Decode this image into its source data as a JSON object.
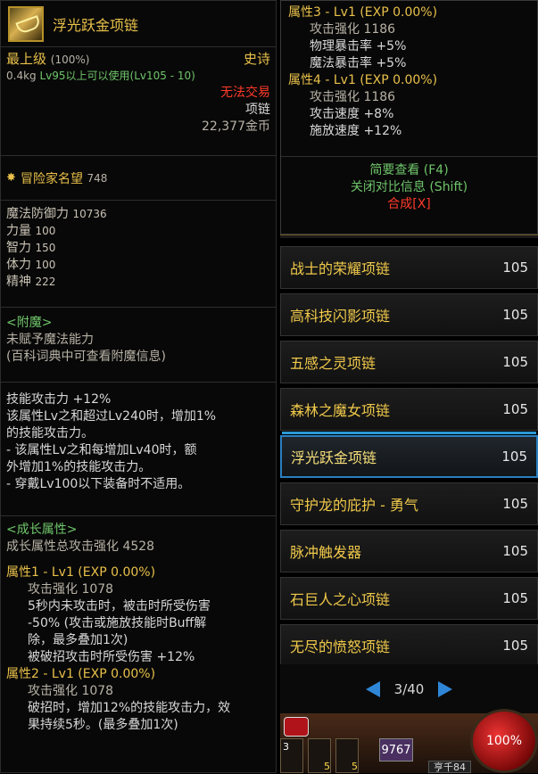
{
  "tooltip": {
    "item_name": "浮光跃金项链",
    "rarity": "最上级",
    "rarity_pct": "(100%)",
    "grade": "史诗",
    "weight": "0.4kg",
    "level_req": "Lv95以上可以使用(Lv105 - 10)",
    "trade": "无法交易",
    "slot": "项链",
    "price": "22,377金币",
    "fame_label": "冒险家名望",
    "fame_value": "748",
    "stats": [
      {
        "name": "魔法防御力",
        "value": "10736"
      },
      {
        "name": "力量",
        "value": "100"
      },
      {
        "name": "智力",
        "value": "150"
      },
      {
        "name": "体力",
        "value": "100"
      },
      {
        "name": "精神",
        "value": "222"
      }
    ],
    "enchant_title": "<附魔>",
    "enchant_line1": "未赋予魔法能力",
    "enchant_line2": "(百科词典中可查看附魔信息)",
    "skill_lines": [
      "技能攻击力 +12%",
      "该属性Lv之和超过Lv240时，增加1%",
      "的技能攻击力。",
      "- 该属性Lv之和每增加Lv40时，额",
      "外增加1%的技能攻击力。",
      "- 穿戴Lv100以下装备时不适用。"
    ],
    "growth_title": "<成长属性>",
    "growth_total": "成长属性总攻击强化 4528",
    "attr1_title": "属性1 - Lv1 (EXP 0.00%)",
    "attr1_lines": [
      "攻击强化 1078",
      "5秒内未攻击时，被击时所受伤害",
      "-50% (攻击或施放技能时Buff解",
      "除，最多叠加1次)",
      "被破招攻击时所受伤害 +12%"
    ],
    "attr2_title": "属性2 - Lv1 (EXP 0.00%)",
    "attr2_lines": [
      "攻击强化 1078",
      "破招时，增加12%的技能攻击力，效",
      "果持续5秒。(最多叠加1次)"
    ]
  },
  "compare": {
    "attr3_title": "属性3 - Lv1 (EXP 0.00%)",
    "attr3_lines": [
      "攻击强化 1186",
      "物理暴击率 +5%",
      "魔法暴击率 +5%"
    ],
    "attr4_title": "属性4 - Lv1 (EXP 0.00%)",
    "attr4_lines": [
      "攻击强化 1186",
      "攻击速度 +8%",
      "施放速度 +12%"
    ],
    "brief_view": "简要查看 (F4)",
    "close_compare": "关闭对比信息 (Shift)",
    "synthesize": "合成[X]"
  },
  "list": {
    "items": [
      {
        "name": "战士的荣耀项链",
        "lv": "105"
      },
      {
        "name": "高科技闪影项链",
        "lv": "105"
      },
      {
        "name": "五感之灵项链",
        "lv": "105"
      },
      {
        "name": "森林之魔女项链",
        "lv": "105"
      },
      {
        "name": "浮光跃金项链",
        "lv": "105"
      },
      {
        "name": "守护龙的庇护 - 勇气",
        "lv": "105"
      },
      {
        "name": "脉冲触发器",
        "lv": "105"
      },
      {
        "name": "石巨人之心项链",
        "lv": "105"
      },
      {
        "name": "无尽的愤怒项链",
        "lv": "105"
      }
    ],
    "page": "3/40"
  },
  "hud": {
    "hp_pct": "100%",
    "counter": "9767",
    "badge": "亨千84",
    "slot1": "3",
    "slot2": "5",
    "slot3": "5"
  },
  "colors": {
    "gold": "#e8c04a",
    "green": "#6fc56a",
    "red": "#ff3a2a",
    "select_blue": "#2a7fc0"
  }
}
